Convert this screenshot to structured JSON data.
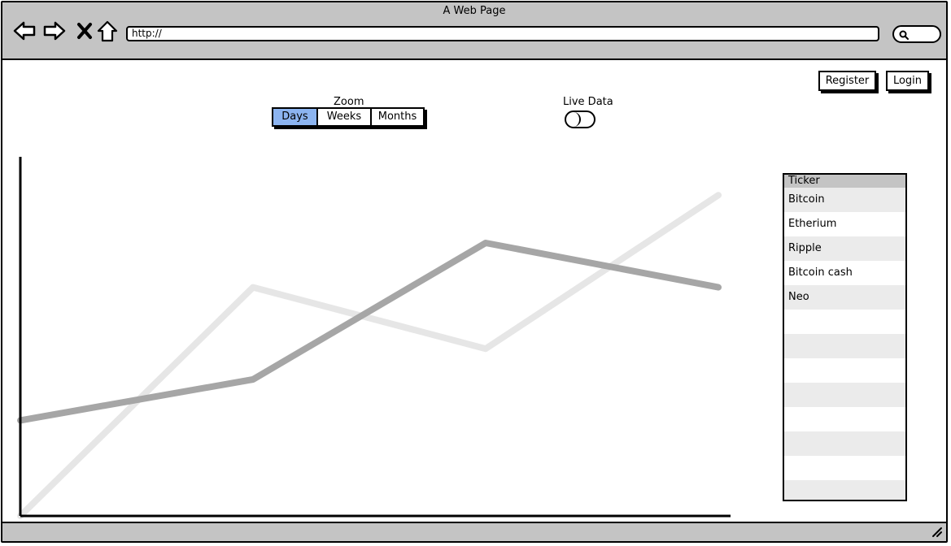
{
  "window": {
    "title": "A Web Page",
    "url": "http://"
  },
  "auth": {
    "register_label": "Register",
    "login_label": "Login"
  },
  "zoom": {
    "label": "Zoom",
    "options": [
      "Days",
      "Weeks",
      "Months"
    ],
    "selected": "Days"
  },
  "live_data": {
    "label": "Live Data",
    "enabled": false
  },
  "ticker": {
    "header": "Ticker",
    "items": [
      "Bitcoin",
      "Etherium",
      "Ripple",
      "Bitcoin cash",
      "Neo"
    ],
    "empty_rows": 8
  },
  "colors": {
    "selected_segment": "#8cb4f0",
    "chrome": "#c4c4c4",
    "series_dark": "#a6a6a6",
    "series_light": "#e6e6e6"
  },
  "icons": [
    "back-arrow-icon",
    "forward-arrow-icon",
    "close-icon",
    "home-icon",
    "search-icon",
    "resize-grip-icon"
  ],
  "chart_data": {
    "type": "line",
    "x": [
      0,
      1,
      2,
      3
    ],
    "series": [
      {
        "values": [
          0.28,
          0.4,
          0.8,
          0.67
        ]
      },
      {
        "values": [
          0.0,
          0.67,
          0.49,
          0.94
        ]
      }
    ],
    "ylim": [
      0,
      1
    ],
    "grid": false
  }
}
